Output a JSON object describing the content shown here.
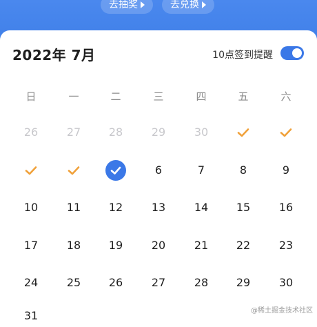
{
  "header": {
    "lottery_label": "去抽奖",
    "exchange_label": "去兑换"
  },
  "calendar": {
    "month_title": "2022年 7月",
    "reminder_label": "10点签到提醒",
    "reminder_on": true,
    "weekdays": [
      "日",
      "一",
      "二",
      "三",
      "四",
      "五",
      "六"
    ],
    "weeks": [
      [
        {
          "text": "26",
          "state": "muted"
        },
        {
          "text": "27",
          "state": "muted"
        },
        {
          "text": "28",
          "state": "muted"
        },
        {
          "text": "29",
          "state": "muted"
        },
        {
          "text": "30",
          "state": "muted"
        },
        {
          "text": "",
          "state": "checked"
        },
        {
          "text": "",
          "state": "checked"
        }
      ],
      [
        {
          "text": "",
          "state": "checked"
        },
        {
          "text": "",
          "state": "checked"
        },
        {
          "text": "",
          "state": "today-checked"
        },
        {
          "text": "6",
          "state": "normal"
        },
        {
          "text": "7",
          "state": "normal"
        },
        {
          "text": "8",
          "state": "normal"
        },
        {
          "text": "9",
          "state": "normal"
        }
      ],
      [
        {
          "text": "10",
          "state": "normal"
        },
        {
          "text": "11",
          "state": "normal"
        },
        {
          "text": "12",
          "state": "normal"
        },
        {
          "text": "13",
          "state": "normal"
        },
        {
          "text": "14",
          "state": "normal"
        },
        {
          "text": "15",
          "state": "normal"
        },
        {
          "text": "16",
          "state": "normal"
        }
      ],
      [
        {
          "text": "17",
          "state": "normal"
        },
        {
          "text": "18",
          "state": "normal"
        },
        {
          "text": "19",
          "state": "normal"
        },
        {
          "text": "20",
          "state": "normal"
        },
        {
          "text": "21",
          "state": "normal"
        },
        {
          "text": "22",
          "state": "normal"
        },
        {
          "text": "23",
          "state": "normal"
        }
      ],
      [
        {
          "text": "24",
          "state": "normal"
        },
        {
          "text": "25",
          "state": "normal"
        },
        {
          "text": "26",
          "state": "normal"
        },
        {
          "text": "27",
          "state": "normal"
        },
        {
          "text": "28",
          "state": "normal"
        },
        {
          "text": "29",
          "state": "normal"
        },
        {
          "text": "30",
          "state": "normal"
        }
      ]
    ],
    "partial_next_row": [
      "31"
    ]
  },
  "colors": {
    "accent": "#3b78e7",
    "check_orange": "#f0a13a",
    "muted": "#c8c8cc"
  },
  "watermark": "@稀土掘金技术社区"
}
